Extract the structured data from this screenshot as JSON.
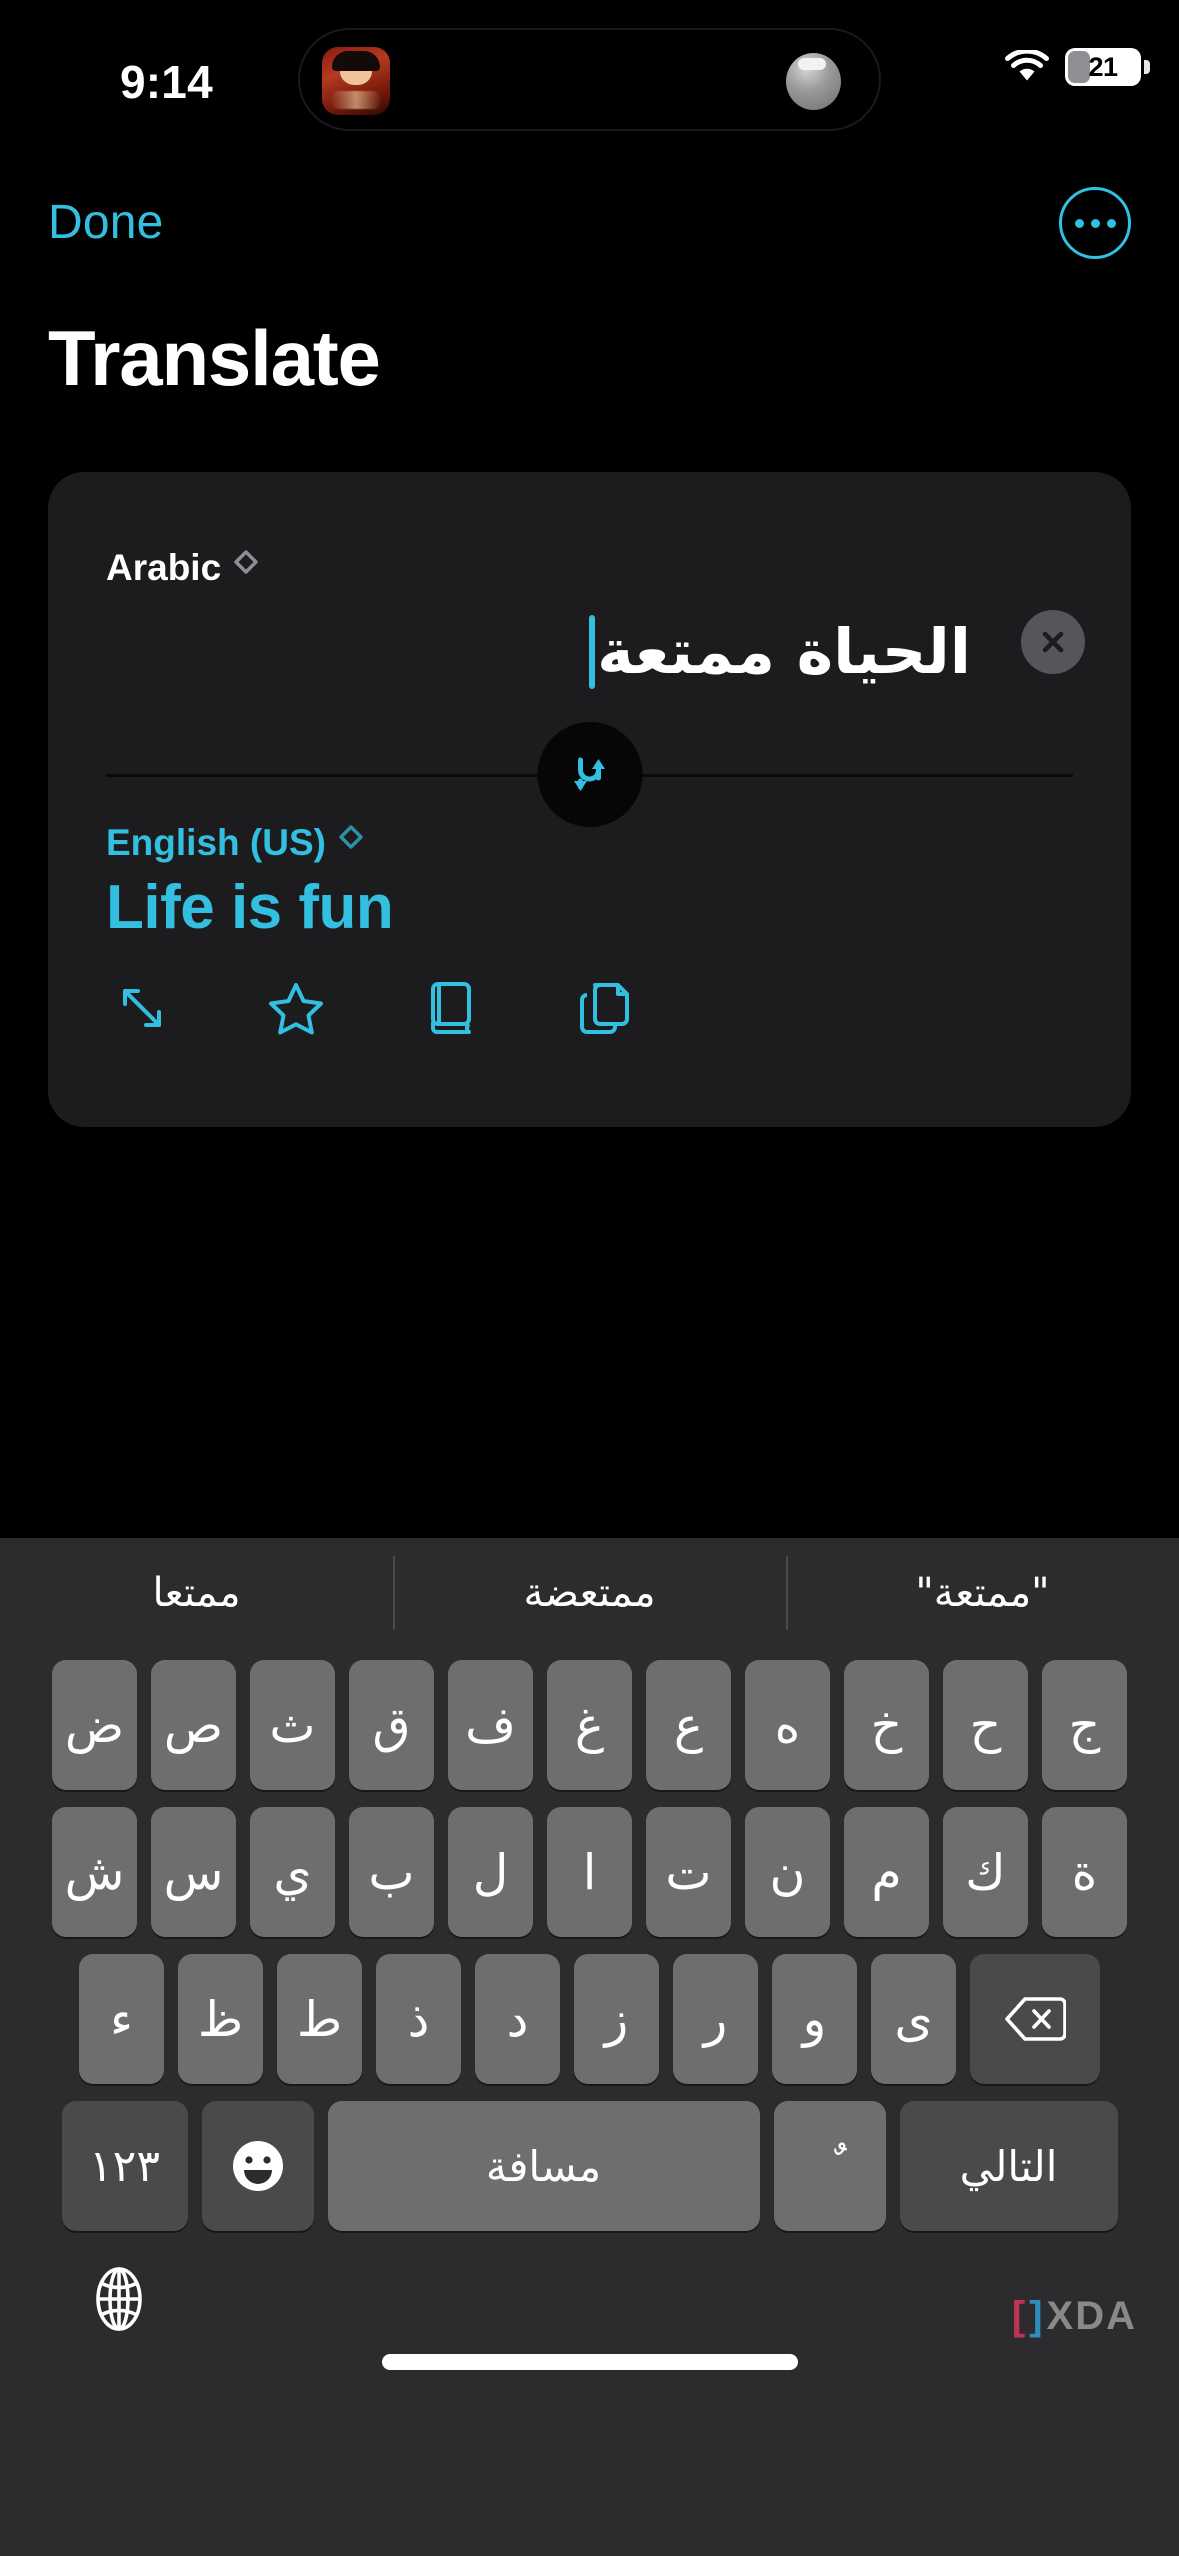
{
  "status_bar": {
    "time": "9:14",
    "battery_percent": "21",
    "wifi_icon": "wifi-icon",
    "dynamic_island_icon": "album-art-thumbnail"
  },
  "nav": {
    "done_label": "Done",
    "more_icon": "ellipsis-circle-icon"
  },
  "page_title": "Translate",
  "card": {
    "source": {
      "language": "Arabic",
      "text": "الحياة ممتعة",
      "chevron_icon": "chevron-up-down-icon",
      "clear_icon": "close-circle-icon"
    },
    "swap_icon": "swap-arrows-icon",
    "target": {
      "language": "English (US)",
      "text": "Life is fun",
      "chevron_icon": "chevron-up-down-icon"
    },
    "actions": [
      {
        "name": "expand-icon",
        "label": "Expand"
      },
      {
        "name": "star-icon",
        "label": "Favorite"
      },
      {
        "name": "book-icon",
        "label": "Dictionary"
      },
      {
        "name": "copy-icon",
        "label": "Copy"
      }
    ]
  },
  "keyboard": {
    "suggestions": [
      "ممتعا",
      "ممتعضة",
      "\"ممتعة\""
    ],
    "row1": [
      "ض",
      "ص",
      "ث",
      "ق",
      "ف",
      "غ",
      "ع",
      "ه",
      "خ",
      "ح",
      "ج"
    ],
    "row2": [
      "ش",
      "س",
      "ي",
      "ب",
      "ل",
      "ا",
      "ت",
      "ن",
      "م",
      "ك",
      "ة"
    ],
    "row3": [
      "ء",
      "ظ",
      "ط",
      "ذ",
      "د",
      "ز",
      "ر",
      "و",
      "ى"
    ],
    "backspace_icon": "backspace-icon",
    "bottom": {
      "numbers_label": "١٢٣",
      "emoji_icon": "emoji-icon",
      "space_label": "مسافة",
      "diacritic_label": "ٌ",
      "next_label": "التالي"
    },
    "globe_icon": "globe-icon"
  },
  "watermark": {
    "bracket_left": "[",
    "bracket_right": "]",
    "text": "XDA"
  },
  "colors": {
    "accent": "#32bfe0",
    "card_bg": "#1c1c1e",
    "keyboard_bg": "#2c2c2e",
    "key_bg": "#6e6e70",
    "key_dark_bg": "#4a4a4c"
  }
}
